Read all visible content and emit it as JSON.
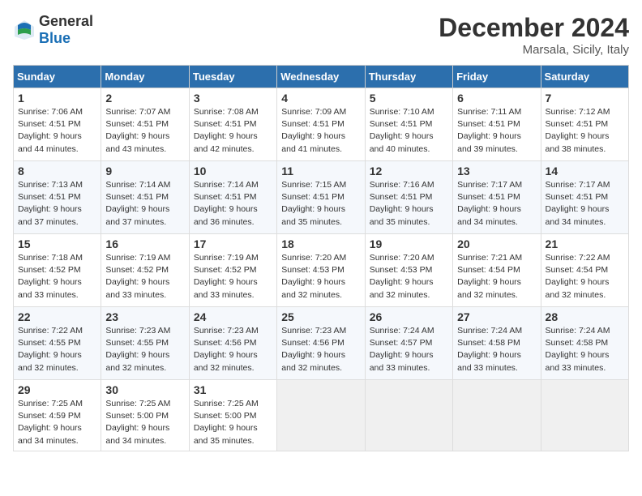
{
  "header": {
    "logo_general": "General",
    "logo_blue": "Blue",
    "month_title": "December 2024",
    "location": "Marsala, Sicily, Italy"
  },
  "weekdays": [
    "Sunday",
    "Monday",
    "Tuesday",
    "Wednesday",
    "Thursday",
    "Friday",
    "Saturday"
  ],
  "weeks": [
    [
      {
        "day": "1",
        "sunrise": "7:06 AM",
        "sunset": "4:51 PM",
        "daylight": "9 hours and 44 minutes."
      },
      {
        "day": "2",
        "sunrise": "7:07 AM",
        "sunset": "4:51 PM",
        "daylight": "9 hours and 43 minutes."
      },
      {
        "day": "3",
        "sunrise": "7:08 AM",
        "sunset": "4:51 PM",
        "daylight": "9 hours and 42 minutes."
      },
      {
        "day": "4",
        "sunrise": "7:09 AM",
        "sunset": "4:51 PM",
        "daylight": "9 hours and 41 minutes."
      },
      {
        "day": "5",
        "sunrise": "7:10 AM",
        "sunset": "4:51 PM",
        "daylight": "9 hours and 40 minutes."
      },
      {
        "day": "6",
        "sunrise": "7:11 AM",
        "sunset": "4:51 PM",
        "daylight": "9 hours and 39 minutes."
      },
      {
        "day": "7",
        "sunrise": "7:12 AM",
        "sunset": "4:51 PM",
        "daylight": "9 hours and 38 minutes."
      }
    ],
    [
      {
        "day": "8",
        "sunrise": "7:13 AM",
        "sunset": "4:51 PM",
        "daylight": "9 hours and 37 minutes."
      },
      {
        "day": "9",
        "sunrise": "7:14 AM",
        "sunset": "4:51 PM",
        "daylight": "9 hours and 37 minutes."
      },
      {
        "day": "10",
        "sunrise": "7:14 AM",
        "sunset": "4:51 PM",
        "daylight": "9 hours and 36 minutes."
      },
      {
        "day": "11",
        "sunrise": "7:15 AM",
        "sunset": "4:51 PM",
        "daylight": "9 hours and 35 minutes."
      },
      {
        "day": "12",
        "sunrise": "7:16 AM",
        "sunset": "4:51 PM",
        "daylight": "9 hours and 35 minutes."
      },
      {
        "day": "13",
        "sunrise": "7:17 AM",
        "sunset": "4:51 PM",
        "daylight": "9 hours and 34 minutes."
      },
      {
        "day": "14",
        "sunrise": "7:17 AM",
        "sunset": "4:51 PM",
        "daylight": "9 hours and 34 minutes."
      }
    ],
    [
      {
        "day": "15",
        "sunrise": "7:18 AM",
        "sunset": "4:52 PM",
        "daylight": "9 hours and 33 minutes."
      },
      {
        "day": "16",
        "sunrise": "7:19 AM",
        "sunset": "4:52 PM",
        "daylight": "9 hours and 33 minutes."
      },
      {
        "day": "17",
        "sunrise": "7:19 AM",
        "sunset": "4:52 PM",
        "daylight": "9 hours and 33 minutes."
      },
      {
        "day": "18",
        "sunrise": "7:20 AM",
        "sunset": "4:53 PM",
        "daylight": "9 hours and 32 minutes."
      },
      {
        "day": "19",
        "sunrise": "7:20 AM",
        "sunset": "4:53 PM",
        "daylight": "9 hours and 32 minutes."
      },
      {
        "day": "20",
        "sunrise": "7:21 AM",
        "sunset": "4:54 PM",
        "daylight": "9 hours and 32 minutes."
      },
      {
        "day": "21",
        "sunrise": "7:22 AM",
        "sunset": "4:54 PM",
        "daylight": "9 hours and 32 minutes."
      }
    ],
    [
      {
        "day": "22",
        "sunrise": "7:22 AM",
        "sunset": "4:55 PM",
        "daylight": "9 hours and 32 minutes."
      },
      {
        "day": "23",
        "sunrise": "7:23 AM",
        "sunset": "4:55 PM",
        "daylight": "9 hours and 32 minutes."
      },
      {
        "day": "24",
        "sunrise": "7:23 AM",
        "sunset": "4:56 PM",
        "daylight": "9 hours and 32 minutes."
      },
      {
        "day": "25",
        "sunrise": "7:23 AM",
        "sunset": "4:56 PM",
        "daylight": "9 hours and 32 minutes."
      },
      {
        "day": "26",
        "sunrise": "7:24 AM",
        "sunset": "4:57 PM",
        "daylight": "9 hours and 33 minutes."
      },
      {
        "day": "27",
        "sunrise": "7:24 AM",
        "sunset": "4:58 PM",
        "daylight": "9 hours and 33 minutes."
      },
      {
        "day": "28",
        "sunrise": "7:24 AM",
        "sunset": "4:58 PM",
        "daylight": "9 hours and 33 minutes."
      }
    ],
    [
      {
        "day": "29",
        "sunrise": "7:25 AM",
        "sunset": "4:59 PM",
        "daylight": "9 hours and 34 minutes."
      },
      {
        "day": "30",
        "sunrise": "7:25 AM",
        "sunset": "5:00 PM",
        "daylight": "9 hours and 34 minutes."
      },
      {
        "day": "31",
        "sunrise": "7:25 AM",
        "sunset": "5:00 PM",
        "daylight": "9 hours and 35 minutes."
      },
      null,
      null,
      null,
      null
    ]
  ]
}
